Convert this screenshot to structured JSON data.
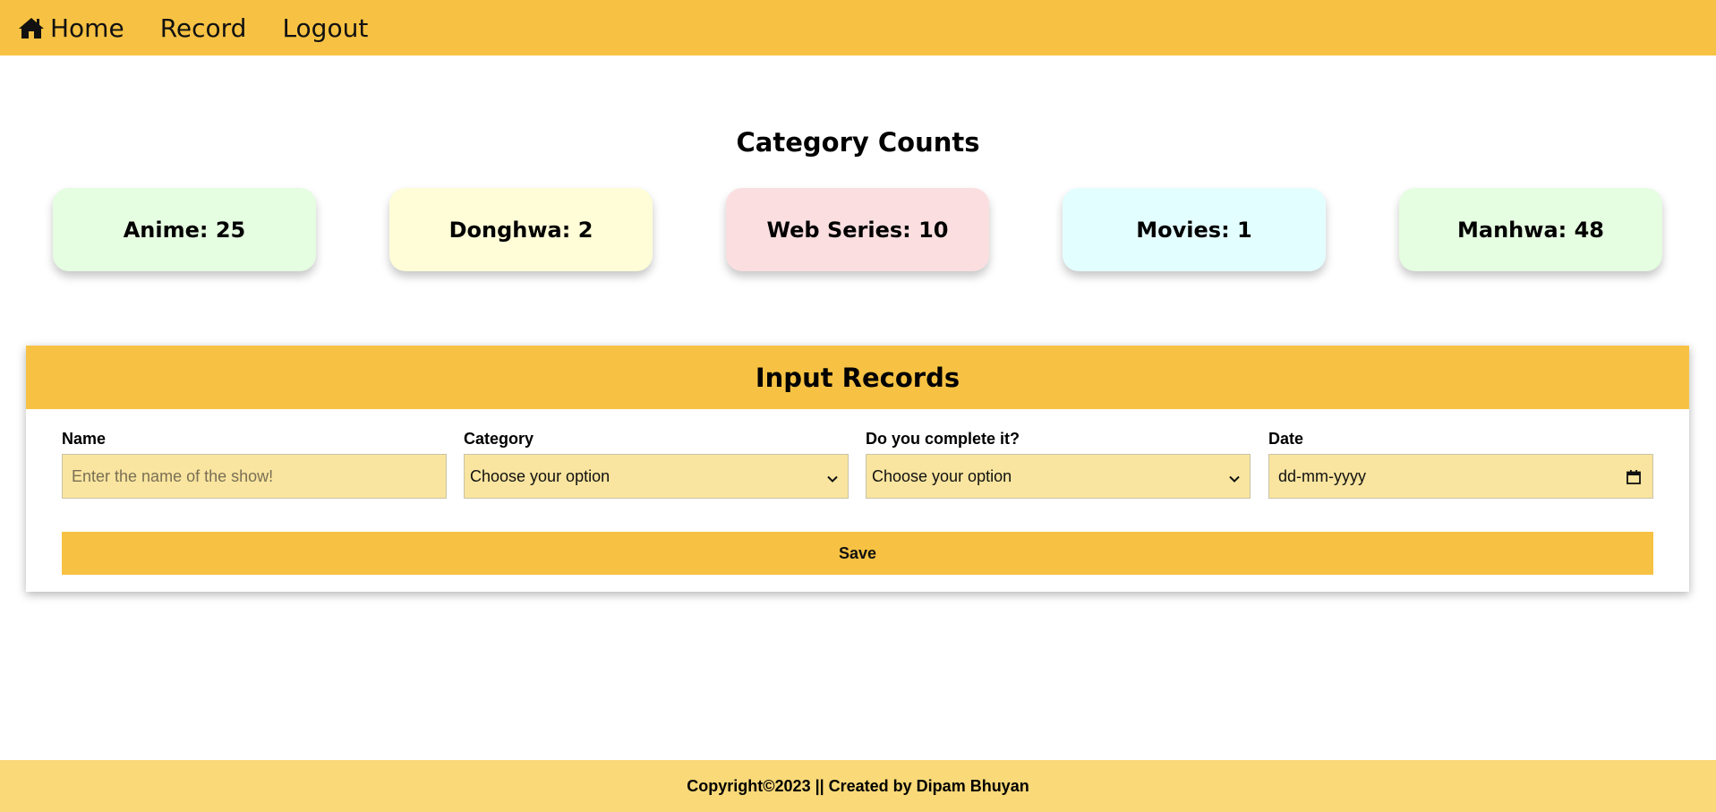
{
  "nav": {
    "items": [
      {
        "label": "Home",
        "icon": "home-icon"
      },
      {
        "label": "Record"
      },
      {
        "label": "Logout"
      }
    ],
    "bg_color": "#f7c243"
  },
  "counts": {
    "title": "Category Counts",
    "cards": [
      {
        "label": "Anime: 25",
        "color": "#e5fde0"
      },
      {
        "label": "Donghwa: 2",
        "color": "#fefdd7"
      },
      {
        "label": "Web Series: 10",
        "color": "#fbdfe0"
      },
      {
        "label": "Movies: 1",
        "color": "#e3feff"
      },
      {
        "label": "Manhwa: 48",
        "color": "#e5fde0"
      }
    ]
  },
  "form": {
    "title": "Input Records",
    "name": {
      "label": "Name",
      "placeholder": "Enter the name of the show!"
    },
    "category": {
      "label": "Category",
      "value": "Choose your option"
    },
    "complete": {
      "label": "Do you complete it?",
      "value": "Choose your option"
    },
    "date": {
      "label": "Date",
      "placeholder": "dd-mm-yyyy"
    },
    "save_label": "Save"
  },
  "footer": {
    "text": "Copyright©2023 || Created by Dipam Bhuyan"
  }
}
